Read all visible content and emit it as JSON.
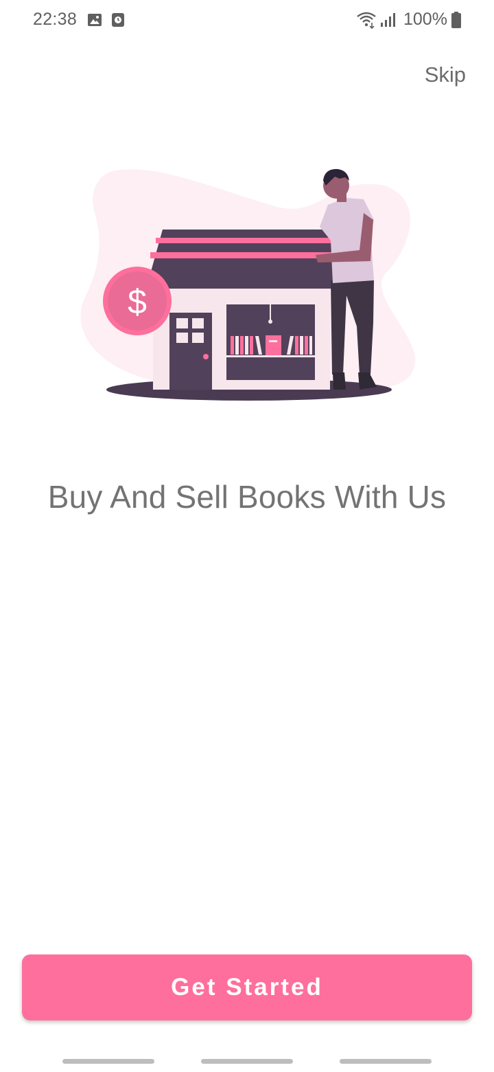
{
  "status_bar": {
    "time": "22:38",
    "battery_percent": "100%",
    "icons": [
      "image-icon",
      "clock-app-icon",
      "wifi-icon",
      "signal-icon",
      "battery-icon"
    ]
  },
  "onboarding": {
    "skip_label": "Skip",
    "illustration": "bookstore-illustration",
    "headline": "Buy And Sell Books With Us",
    "cta_label": "Get Started",
    "page_count": 3
  },
  "colors": {
    "accent": "#fe6f9d",
    "dark": "#52415a",
    "light_wall": "#f7e7ec",
    "blob": "#fdeff3",
    "text_gray": "#737373"
  }
}
